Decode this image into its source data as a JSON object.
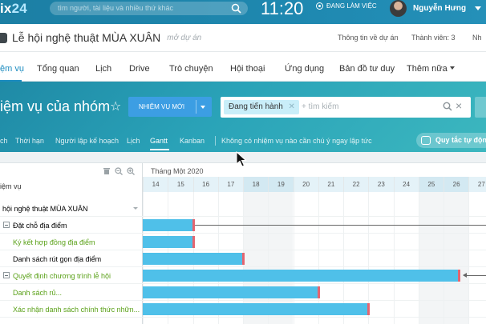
{
  "topbar": {
    "logo_prefix": "ix",
    "logo_number": "24",
    "search_placeholder": "tìm người, tài liệu và nhiều thứ khác",
    "clock": "11:20",
    "status": "ĐANG LÀM VIỆC",
    "user_name": "Nguyễn Hưng"
  },
  "workgroup": {
    "name": "Lễ hội nghệ thuật MÙA XUÂN",
    "subtitle": "mở dự án",
    "links": [
      "Thông tin về dự án",
      "Thành viên: 3",
      "Nh"
    ]
  },
  "menu": {
    "items": [
      "ệm vụ",
      "Tổng quan",
      "Lịch",
      "Drive",
      "Trò chuyện",
      "Hội thoại",
      "Ứng dụng",
      "Bản đồ tư duy",
      "Thêm nữa"
    ],
    "active_index": 0
  },
  "banner": {
    "title": "iệm vụ của nhóm",
    "new_task_button": "NHIỆM VỤ MỚI",
    "filter_chip": "Đang tiến hành",
    "filter_placeholder": "+ tìm kiếm",
    "subnav": [
      "ch",
      "Thời hạn",
      "Người lập kế hoạch",
      "Lịch",
      "Gantt",
      "Kanban"
    ],
    "subnav_active": "Gantt",
    "notice": "Không có nhiệm vụ nào cần chú ý ngay lập tức",
    "rules_button": "Quy tắc tự độn"
  },
  "gantt": {
    "column_header": "iệm vụ",
    "month_label": "Tháng Một 2020",
    "days": [
      "14",
      "15",
      "16",
      "17",
      "18",
      "19",
      "20",
      "21",
      "22",
      "23",
      "24",
      "25",
      "26",
      "27"
    ],
    "weekend_days": [
      "18",
      "19",
      "25",
      "26"
    ],
    "rows": [
      {
        "label": "hội nghệ thuật MÙA XUÂN",
        "style": "project",
        "start": null,
        "end": null
      },
      {
        "label": "Đặt chỗ địa điểm",
        "style": "parent",
        "start": 0,
        "end": 2
      },
      {
        "label": "Ký kết hợp đồng địa điểm",
        "style": "green",
        "start": 0,
        "end": 2
      },
      {
        "label": "Danh sách rút gọn địa điểm",
        "style": "plain",
        "start": 0,
        "end": 4
      },
      {
        "label": "Quyết định chương trình lễ hội",
        "style": "parent-green",
        "start": 0,
        "end": 12.6
      },
      {
        "label": "Danh sách rủ...",
        "style": "green",
        "start": 0,
        "end": 7
      },
      {
        "label": "Xác nhận danh sách chính thức nhữn...",
        "style": "green",
        "start": 0,
        "end": 9
      }
    ]
  },
  "colors": {
    "topbar": "#1e88b0",
    "accent": "#1b8bbf",
    "bar": "#4fc0e9",
    "bar_end": "#e46570",
    "green_text": "#5aa118"
  }
}
